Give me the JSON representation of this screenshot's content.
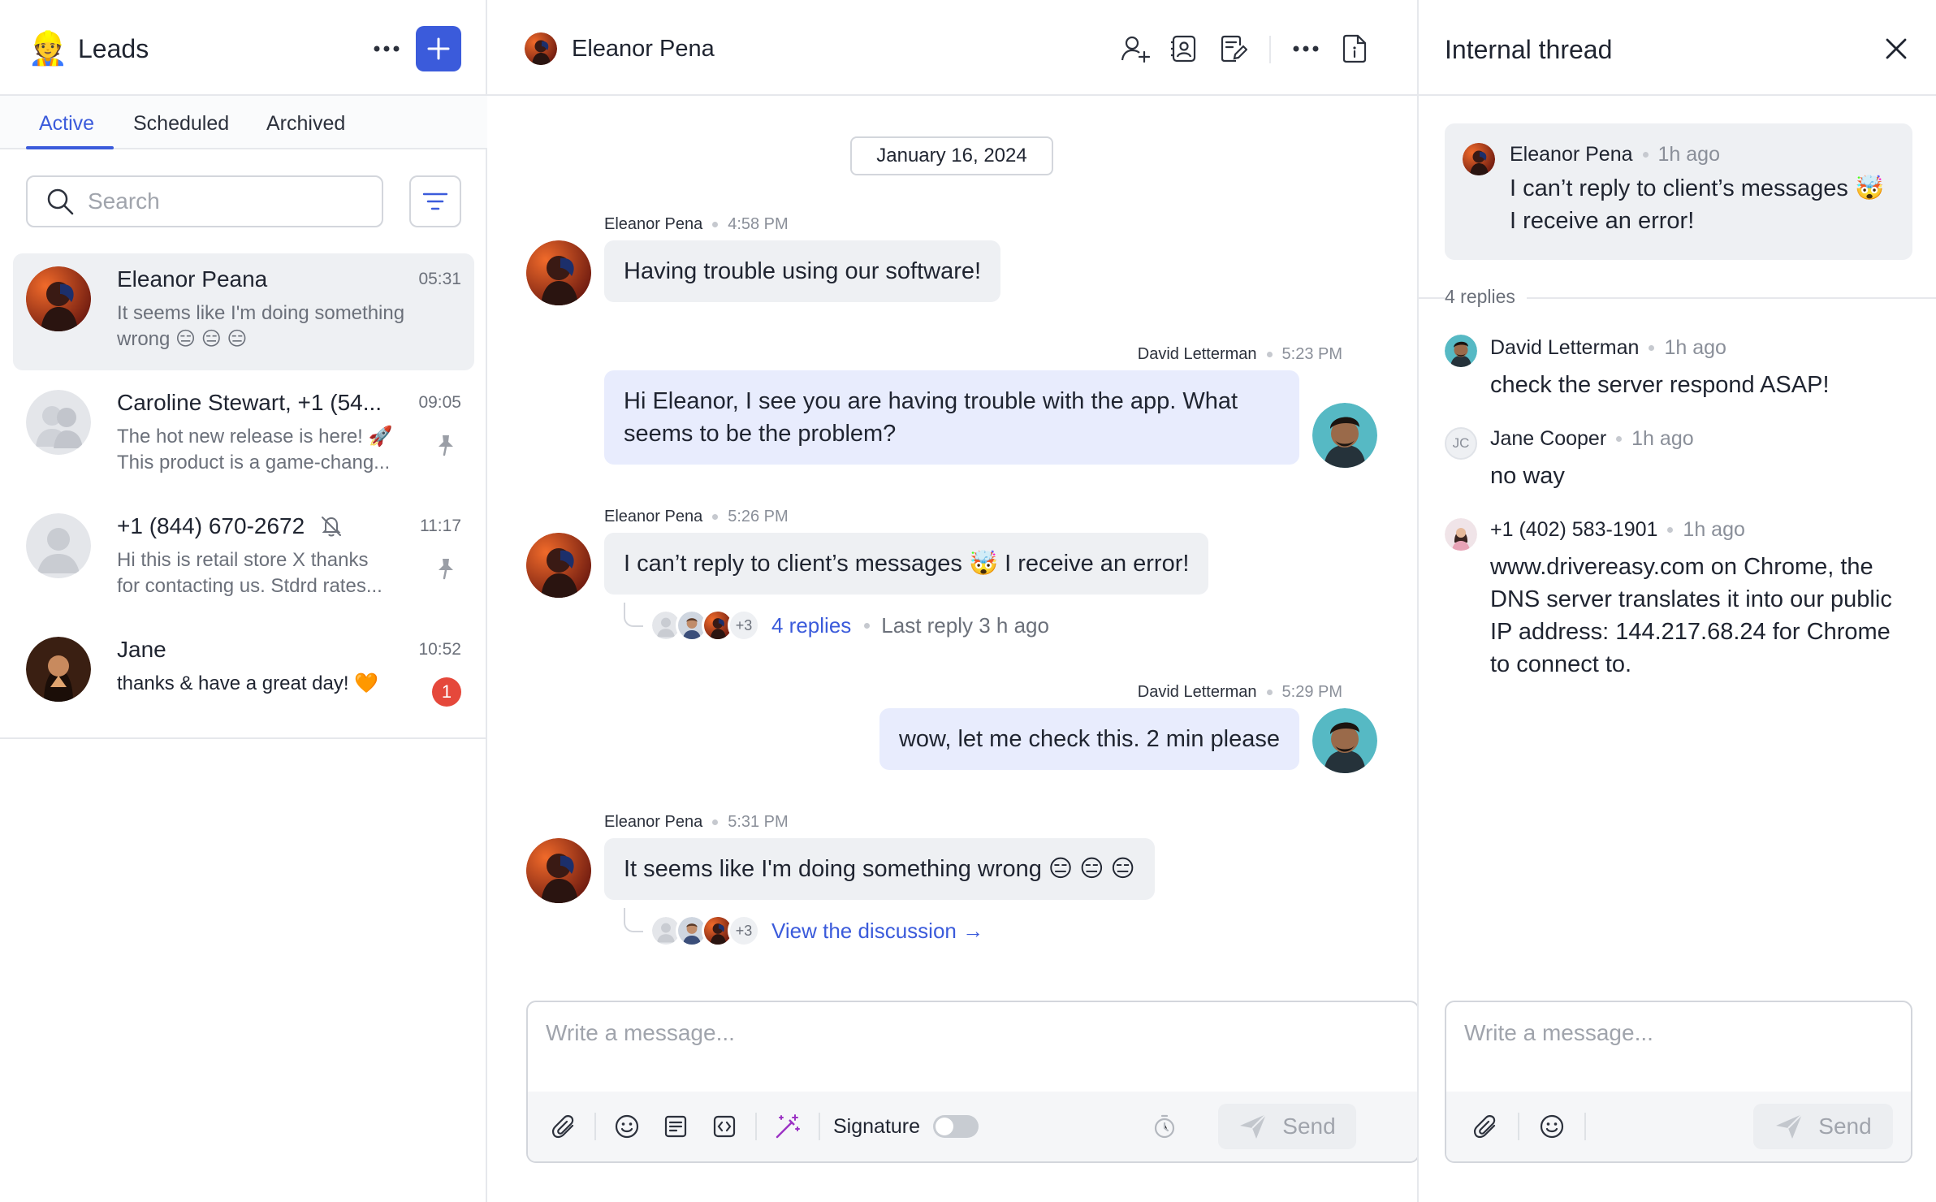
{
  "sidebar": {
    "title": "Leads",
    "title_emoji": "👷",
    "tabs": [
      {
        "label": "Active",
        "active": true
      },
      {
        "label": "Scheduled",
        "active": false
      },
      {
        "label": "Archived",
        "active": false
      }
    ],
    "search": {
      "placeholder": "Search",
      "value": ""
    },
    "conversations": [
      {
        "name": "Eleanor Peana",
        "time": "05:31",
        "preview_line1": "It seems like I'm doing something",
        "preview_line2": "wrong 😑 😑 😑",
        "selected": true,
        "pinned": false,
        "muted": false,
        "unread": null
      },
      {
        "name": "Caroline Stewart, +1 (54...",
        "time": "09:05",
        "preview_line1": "The hot new release is here! 🚀",
        "preview_line2": "This product is a game-chang...",
        "selected": false,
        "pinned": true,
        "muted": false,
        "unread": null
      },
      {
        "name": "+1 (844) 670-2672",
        "time": "11:17",
        "preview_line1": "Hi this is retail store X thanks",
        "preview_line2": "for contacting us. Stdrd rates...",
        "selected": false,
        "pinned": true,
        "muted": true,
        "unread": null
      },
      {
        "name": "Jane",
        "time": "10:52",
        "preview_line1": "thanks & have a great day! 🧡",
        "preview_line2": "",
        "selected": false,
        "pinned": false,
        "muted": false,
        "unread": "1"
      }
    ]
  },
  "conversation": {
    "contact_name": "Eleanor Pena",
    "header_icons": [
      "add-user-icon",
      "contact-card-icon",
      "edit-note-icon",
      "more-icon",
      "document-info-icon"
    ],
    "date_divider": "January 16, 2024",
    "messages": [
      {
        "author": "Eleanor Pena",
        "time": "4:58 PM",
        "text": "Having trouble using our software!",
        "direction": "in"
      },
      {
        "author": "David Letterman",
        "time": "5:23 PM",
        "text": "Hi Eleanor, I see you are having trouble with the app. What seems to be the problem?",
        "direction": "out"
      },
      {
        "author": "Eleanor Pena",
        "time": "5:26 PM",
        "text": "I can’t reply to client’s messages 🤯 I receive an error!",
        "direction": "in",
        "thread": {
          "extra": "+3",
          "replies_label": "4 replies",
          "last_reply": "Last reply 3 h ago"
        }
      },
      {
        "author": "David Letterman",
        "time": "5:29 PM",
        "text": "wow, let me check this. 2 min please",
        "direction": "out"
      },
      {
        "author": "Eleanor Pena",
        "time": "5:31 PM",
        "text": "It seems like I'm doing something wrong 😑 😑 😑",
        "direction": "in",
        "thread": {
          "extra": "+3",
          "link_label": "View the discussion →"
        }
      }
    ],
    "composer": {
      "placeholder": "Write a message...",
      "signature_label": "Signature",
      "signature_on": false,
      "send_label": "Send"
    }
  },
  "thread": {
    "title": "Internal thread",
    "root": {
      "author": "Eleanor Pena",
      "time": "1h ago",
      "line1": "I can’t reply to client’s messages 🤯",
      "line2": "I receive an error!"
    },
    "replies_count": "4 replies",
    "replies": [
      {
        "author": "David Letterman",
        "time": "1h ago",
        "text": "check the server respond ASAP!",
        "initials": ""
      },
      {
        "author": "Jane Cooper",
        "time": "1h ago",
        "text": "no way",
        "initials": "JC"
      },
      {
        "author": "+1 (402) 583-1901",
        "time": "1h ago",
        "text": "www.drivereasy.com on Chrome, the DNS server translates it into our public IP address: 144.217.68.24 for Chrome to connect to.",
        "initials": ""
      }
    ],
    "composer": {
      "placeholder": "Write a message...",
      "send_label": "Send"
    }
  },
  "colors": {
    "accent": "#3b5bdb",
    "badge": "#e5483b",
    "bubble_in": "#eef0f3",
    "bubble_out": "#e8ecfd"
  }
}
